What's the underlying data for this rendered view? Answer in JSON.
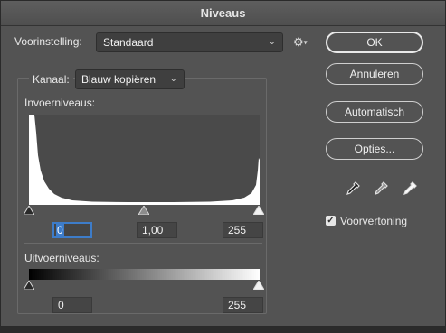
{
  "dialog": {
    "title": "Niveaus"
  },
  "preset": {
    "label": "Voorinstelling:",
    "value": "Standaard"
  },
  "channel": {
    "label": "Kanaal:",
    "value": "Blauw kopiëren"
  },
  "input_levels": {
    "label": "Invoerniveaus:",
    "black": "0",
    "gamma": "1,00",
    "white": "255"
  },
  "output_levels": {
    "label": "Uitvoerniveaus:",
    "black": "0",
    "white": "255"
  },
  "buttons": {
    "ok": "OK",
    "cancel": "Annuleren",
    "auto": "Automatisch",
    "options": "Opties..."
  },
  "preview": {
    "label": "Voorvertoning",
    "checked": true
  },
  "colors": {
    "dialog_bg": "#535353",
    "focus_accent": "#3d7cc9"
  }
}
